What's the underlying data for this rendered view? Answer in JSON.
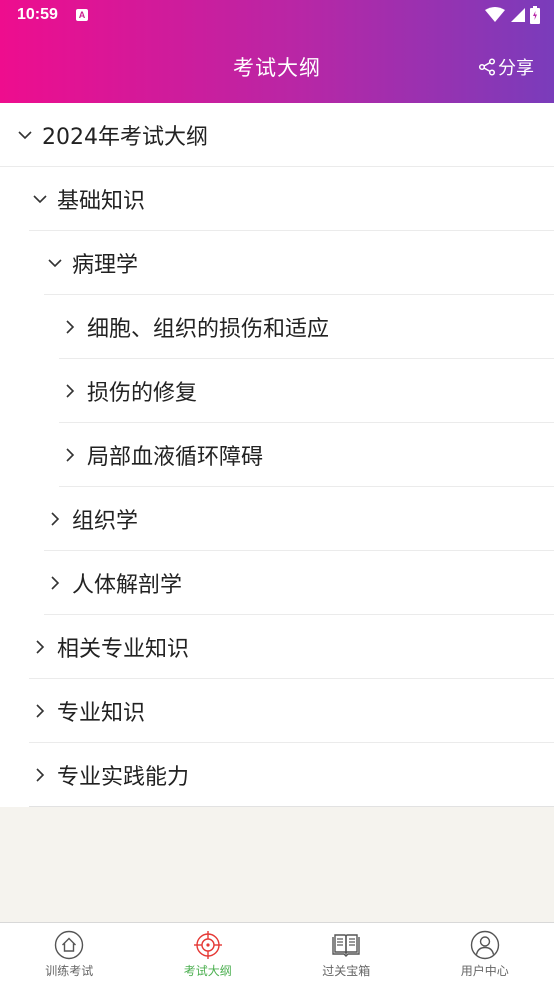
{
  "status_bar": {
    "time": "10:59",
    "notif_letter": "A"
  },
  "header": {
    "title": "考试大纲",
    "share_label": "分享"
  },
  "tree": [
    {
      "label": "2024年考试大纲",
      "level": 0,
      "expanded": true
    },
    {
      "label": "基础知识",
      "level": 1,
      "expanded": true
    },
    {
      "label": "病理学",
      "level": 2,
      "expanded": true
    },
    {
      "label": "细胞、组织的损伤和适应",
      "level": 3,
      "expanded": false
    },
    {
      "label": "损伤的修复",
      "level": 3,
      "expanded": false
    },
    {
      "label": "局部血液循环障碍",
      "level": 3,
      "expanded": false
    },
    {
      "label": "组织学",
      "level": 2,
      "expanded": false
    },
    {
      "label": "人体解剖学",
      "level": 2,
      "expanded": false
    },
    {
      "label": "相关专业知识",
      "level": 1,
      "expanded": false
    },
    {
      "label": "专业知识",
      "level": 1,
      "expanded": false
    },
    {
      "label": "专业实践能力",
      "level": 1,
      "expanded": false
    }
  ],
  "tabbar": {
    "items": [
      {
        "label": "训练考试",
        "icon": "home-icon",
        "active": false
      },
      {
        "label": "考试大纲",
        "icon": "target-icon",
        "active": true
      },
      {
        "label": "过关宝箱",
        "icon": "book-icon",
        "active": false
      },
      {
        "label": "用户中心",
        "icon": "user-icon",
        "active": false
      }
    ]
  },
  "colors": {
    "header_start": "#ee0d8e",
    "header_end": "#7a3cbb",
    "active_tab_icon": "#e53935",
    "active_tab_label": "#4caf50"
  }
}
